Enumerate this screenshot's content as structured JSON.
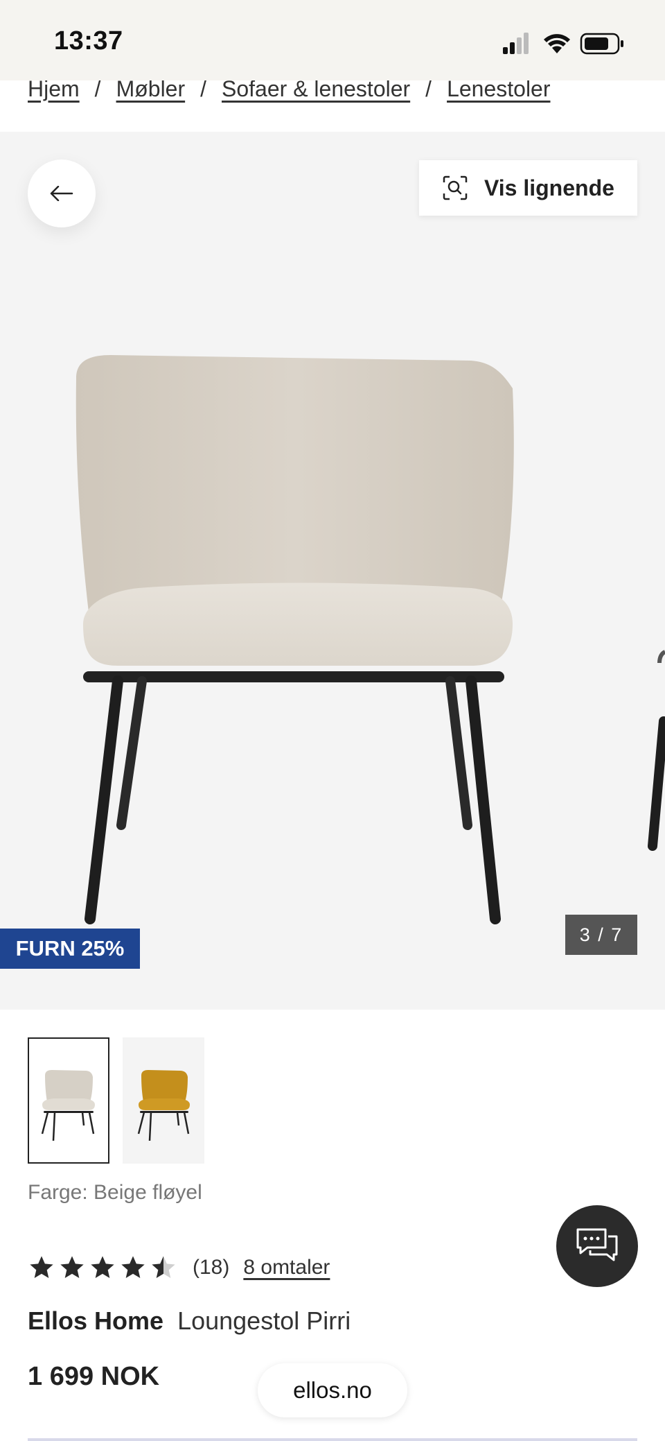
{
  "status_bar": {
    "time": "13:37"
  },
  "breadcrumb": [
    "Hjem",
    "Møbler",
    "Sofaer & lenestoler",
    "Lenestoler"
  ],
  "gallery": {
    "similar_button": "Vis lignende",
    "promo_badge": "FURN 25%",
    "counter": "3 / 7"
  },
  "swatches": [
    {
      "color_name": "Beige fløyel",
      "hex": "#d8d2c8",
      "selected": true
    },
    {
      "color_name": "Gul",
      "hex": "#c9921c",
      "selected": false
    }
  ],
  "product": {
    "color_label": "Farge: Beige fløyel",
    "rating": 4.5,
    "rating_max": 5,
    "rating_count": "(18)",
    "reviews_link": "8 omtaler",
    "brand": "Ellos Home",
    "name": "Loungestol Pirri",
    "price": "1 699 NOK"
  },
  "browser": {
    "url": "ellos.no"
  },
  "colors": {
    "promo": "#1f4591",
    "counter_bg": "#555555",
    "chat_bg": "#2b2b2b"
  }
}
